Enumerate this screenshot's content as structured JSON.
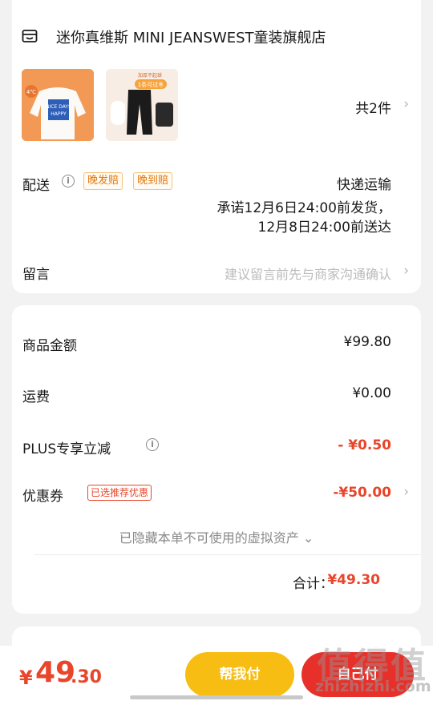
{
  "store": {
    "name": "迷你真维斯 MINI JEANSWEST童装旗舰店",
    "item_count": "共2件",
    "products": [
      {
        "thumb_text": "NICE DAYS HAPPY",
        "badge": "4℃"
      },
      {
        "thumb_text": "1条可过冬",
        "top_text": "加厚不起球"
      }
    ]
  },
  "delivery": {
    "label": "配送",
    "badges": [
      "晚发赔",
      "晚到赔"
    ],
    "method": "快递运输",
    "promise_line1": "承诺12月6日24:00前发货，",
    "promise_line2": "12月8日24:00前送达"
  },
  "message": {
    "label": "留言",
    "placeholder": "建议留言前先与商家沟通确认"
  },
  "summary": {
    "goods_label": "商品金额",
    "goods_value": "¥99.80",
    "shipping_label": "运费",
    "shipping_value": "¥0.00",
    "plus_label": "PLUS专享立减",
    "plus_value": "- ¥0.50",
    "coupon_label": "优惠券",
    "coupon_badge": "已选推荐优惠",
    "coupon_value": "-¥50.00",
    "hidden_note": "已隐藏本单不可使用的虚拟资产 ⌄",
    "total_label": "合计：",
    "total_value": "¥49.30"
  },
  "bottom": {
    "price_symbol": "¥",
    "price_int": "49",
    "price_dec": ".30",
    "help_pay": "帮我付",
    "self_pay": "自己付"
  },
  "watermark": {
    "main": "值得值",
    "sub": "zhizhizhi.com"
  },
  "colors": {
    "accent_red": "#e8452a",
    "pay_yellow": "#f7bd13",
    "pay_red": "#e8302a",
    "badge_orange": "#e07a10"
  },
  "icons": [
    "store-icon",
    "info-icon",
    "chevron-right-icon"
  ]
}
